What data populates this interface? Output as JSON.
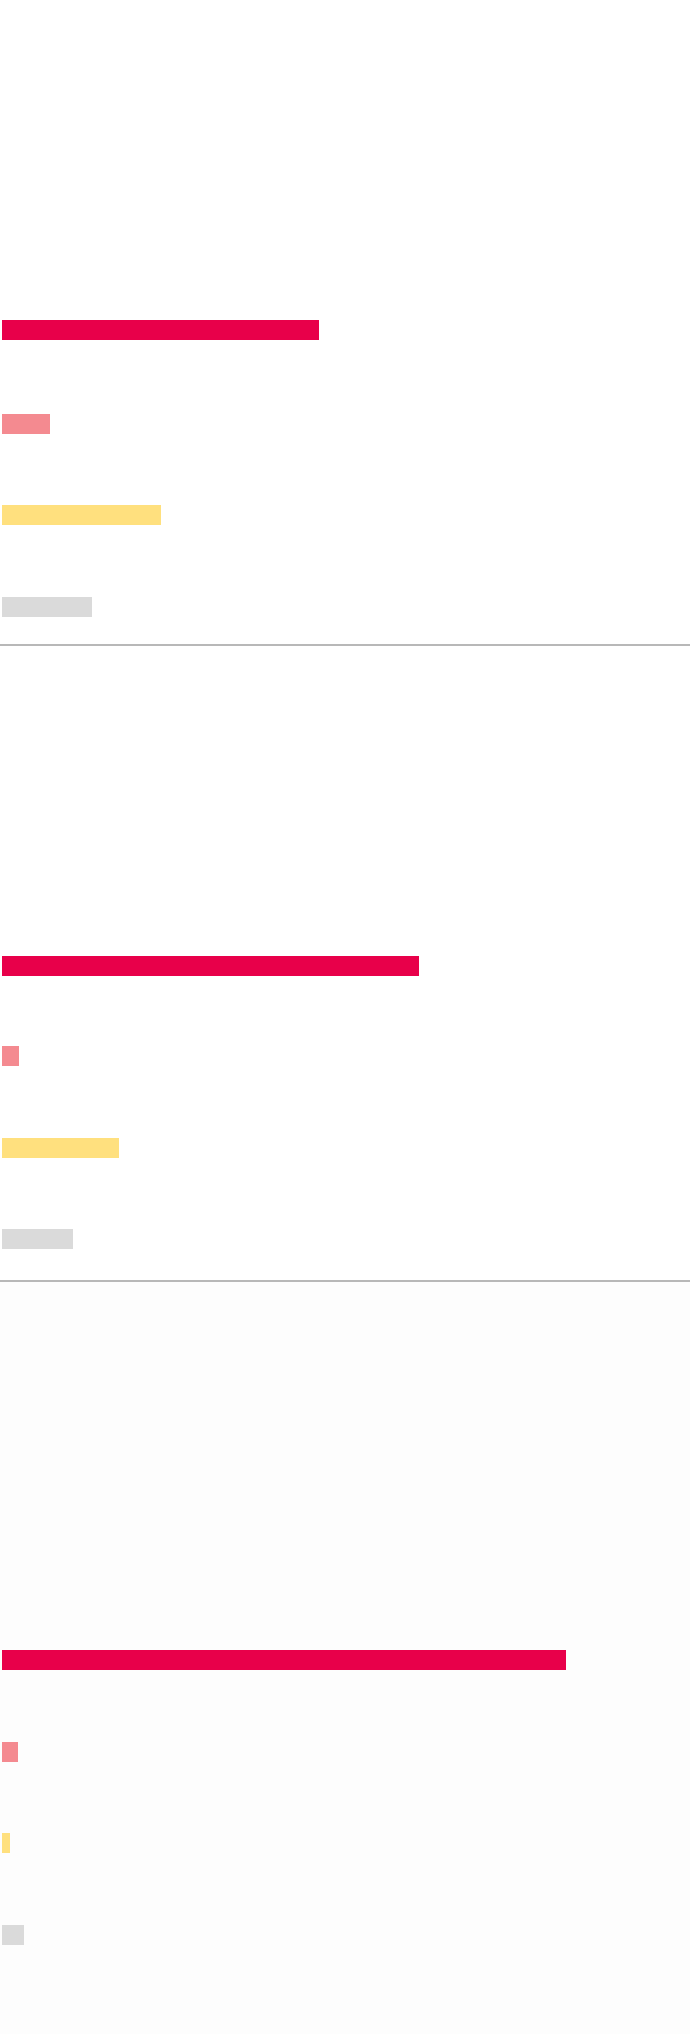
{
  "chart_data": [
    {
      "type": "bar",
      "orientation": "horizontal",
      "xlim": [
        0,
        100
      ],
      "series": [
        {
          "values": [
            46,
            7,
            23,
            13
          ],
          "colors": [
            "#e8004a",
            "#f48a90",
            "#ffe07e",
            "#dadada"
          ]
        }
      ]
    },
    {
      "type": "bar",
      "orientation": "horizontal",
      "xlim": [
        0,
        100
      ],
      "series": [
        {
          "values": [
            60.5,
            2.5,
            17,
            10.3
          ],
          "colors": [
            "#e8004a",
            "#f48a90",
            "#ffe07e",
            "#dadada"
          ]
        }
      ]
    },
    {
      "type": "bar",
      "orientation": "horizontal",
      "xlim": [
        0,
        100
      ],
      "series": [
        {
          "values": [
            81.8,
            2.3,
            1.1,
            3.2
          ],
          "colors": [
            "#e8004a",
            "#f48a90",
            "#ffe07e",
            "#dadada"
          ]
        }
      ]
    }
  ]
}
